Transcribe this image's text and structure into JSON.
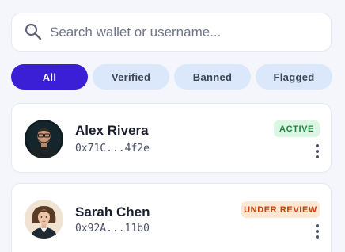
{
  "search": {
    "placeholder": "Search wallet or username...",
    "value": ""
  },
  "filters": {
    "items": [
      {
        "label": "All",
        "active": true
      },
      {
        "label": "Verified",
        "active": false
      },
      {
        "label": "Banned",
        "active": false
      },
      {
        "label": "Flagged",
        "active": false
      }
    ]
  },
  "users": [
    {
      "name": "Alex Rivera",
      "address": "0x71C...4f2e",
      "status": "ACTIVE",
      "status_color": "#1b8a3f",
      "status_bg": "#dcf6e4"
    },
    {
      "name": "Sarah Chen",
      "address": "0x92A...11b0",
      "status": "UNDER REVIEW",
      "status_color": "#c2410c",
      "status_bg": "#fde9d3"
    }
  ],
  "colors": {
    "accent": "#3a1fd6",
    "chip_bg": "#dbe7fa",
    "background": "#f5f6fb"
  },
  "icons": {
    "search": "search-icon",
    "more": "more-vertical-icon"
  }
}
